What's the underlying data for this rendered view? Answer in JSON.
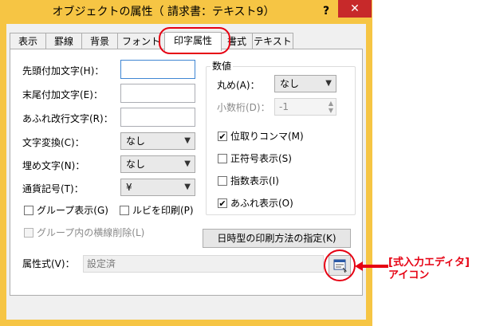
{
  "window": {
    "title": "オブジェクトの属性（ 請求書：テキスト9）",
    "help_label": "?",
    "close_label": "✕"
  },
  "tabs": [
    {
      "label": "表示"
    },
    {
      "label": "罫線"
    },
    {
      "label": "背景"
    },
    {
      "label": "フォント"
    },
    {
      "label": "印字属性",
      "active": true
    },
    {
      "label": "書式"
    },
    {
      "label": "テキスト"
    }
  ],
  "form": {
    "prefix_label": "先頭付加文字(H)：",
    "suffix_label": "末尾付加文字(E)：",
    "overflow_newline_label": "あふれ改行文字(R)：",
    "char_convert": {
      "label": "文字変換(C)：",
      "value": "なし"
    },
    "fill_char": {
      "label": "埋め文字(N)：",
      "value": "なし"
    },
    "currency": {
      "label": "通貨記号(T)：",
      "value": "¥"
    },
    "group_display": {
      "label": "グループ表示(G)",
      "checked": false
    },
    "ruby_print": {
      "label": "ルビを印刷(P)",
      "checked": false
    },
    "group_line_delete": {
      "label": "グループ内の横線削除(L)",
      "checked": false,
      "disabled": true
    },
    "attr_expr": {
      "label": "属性式(V)：",
      "value": "設定済"
    }
  },
  "numeric": {
    "group_label": "数値",
    "rounding": {
      "label": "丸め(A)：",
      "value": "なし"
    },
    "decimal_places": {
      "label": "小数桁(D)：",
      "value": "-1"
    },
    "comma": {
      "label": "位取りコンマ(M)",
      "checked": true
    },
    "plus_sign": {
      "label": "正符号表示(S)",
      "checked": false
    },
    "exponent": {
      "label": "指数表示(I)",
      "checked": false
    },
    "overflow_display": {
      "label": "あふれ表示(O)",
      "checked": true
    }
  },
  "date_button_label": "日時型の印刷方法の指定(K)",
  "annotation": {
    "line1": "[式入力エディタ]",
    "line2": "アイコン"
  },
  "colors": {
    "frame": "#f6c544",
    "close": "#c7292a",
    "annotation": "#e60012"
  }
}
